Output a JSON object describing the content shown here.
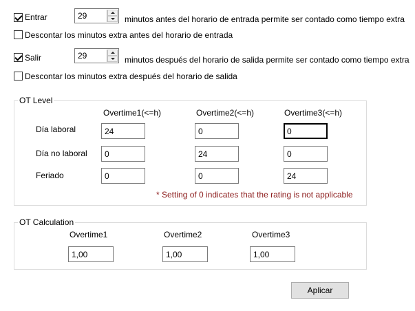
{
  "entrada": {
    "checkbox_label": "Entrar",
    "checked": true,
    "minutes": "29",
    "description": "minutos antes del horario de entrada permite ser contado como tiempo extra",
    "discount_label": "Descontar los minutos extra antes del horario de entrada",
    "discount_checked": false
  },
  "salida": {
    "checkbox_label": "Salir",
    "checked": true,
    "minutes": "29",
    "description": "minutos después del horario de salida permite ser contado como tiempo extra",
    "discount_label": "Descontar los minutos extra después del horario de salida",
    "discount_checked": false
  },
  "ot_level": {
    "legend": "OT Level",
    "columns": [
      "Overtime1(<=h)",
      "Overtime2(<=h)",
      "Overtime3(<=h)"
    ],
    "rows": [
      {
        "label": "Día laboral",
        "values": [
          "24",
          "0",
          "0"
        ]
      },
      {
        "label": "Día no laboral",
        "values": [
          "0",
          "24",
          "0"
        ]
      },
      {
        "label": "Feriado",
        "values": [
          "0",
          "0",
          "24"
        ]
      }
    ],
    "note": "* Setting of 0 indicates that the rating is not applicable"
  },
  "ot_calculation": {
    "legend": "OT Calculation",
    "columns": [
      "Overtime1",
      "Overtime2",
      "Overtime3"
    ],
    "values": [
      "1,00",
      "1,00",
      "1,00"
    ]
  },
  "apply_label": "Aplicar"
}
